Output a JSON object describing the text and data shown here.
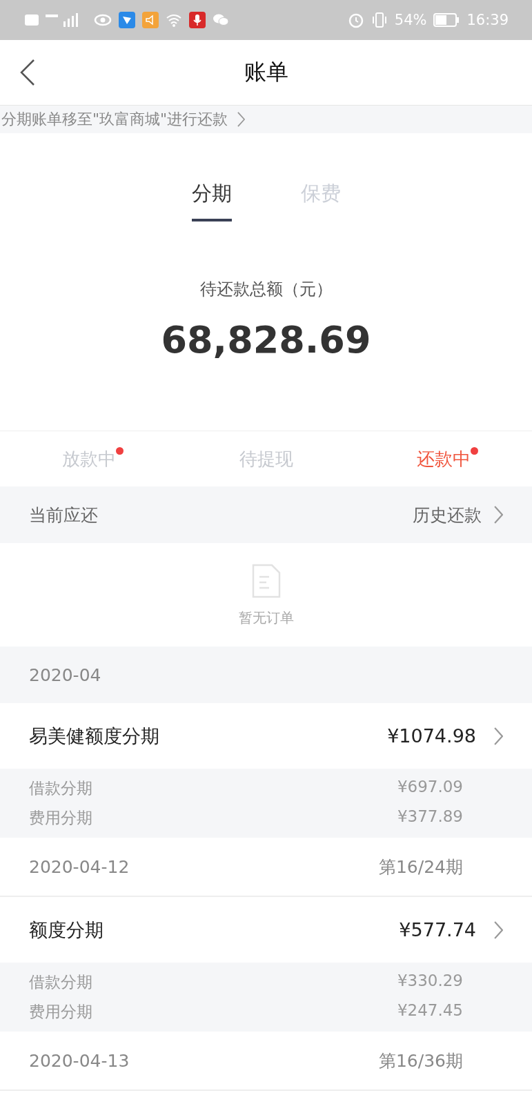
{
  "status_bar": {
    "battery": "54%",
    "time": "16:39"
  },
  "nav": {
    "title": "账单"
  },
  "notice": {
    "text": "分期账单移至\"玖富商城\"进行还款"
  },
  "tabs": [
    {
      "label": "分期",
      "selected": true
    },
    {
      "label": "保费",
      "selected": false
    }
  ],
  "summary": {
    "label": "待还款总额（元）",
    "amount": "68,828.69"
  },
  "status_tabs": [
    {
      "label": "放款中",
      "selected": false,
      "dot": true
    },
    {
      "label": "待提现",
      "selected": false,
      "dot": false
    },
    {
      "label": "还款中",
      "selected": true,
      "dot": true
    }
  ],
  "current": {
    "label": "当前应还",
    "link": "历史还款"
  },
  "empty": {
    "text": "暂无订单"
  },
  "month": "2020-04",
  "bills": [
    {
      "title": "易美健额度分期",
      "amount": "¥1074.98",
      "details": [
        {
          "label": "借款分期",
          "value": "¥697.09"
        },
        {
          "label": "费用分期",
          "value": "¥377.89"
        }
      ],
      "date": "2020-04-12",
      "period": "第16/24期"
    },
    {
      "title": "额度分期",
      "amount": "¥577.74",
      "details": [
        {
          "label": "借款分期",
          "value": "¥330.29"
        },
        {
          "label": "费用分期",
          "value": "¥247.45"
        }
      ],
      "date": "2020-04-13",
      "period": "第16/36期"
    }
  ]
}
